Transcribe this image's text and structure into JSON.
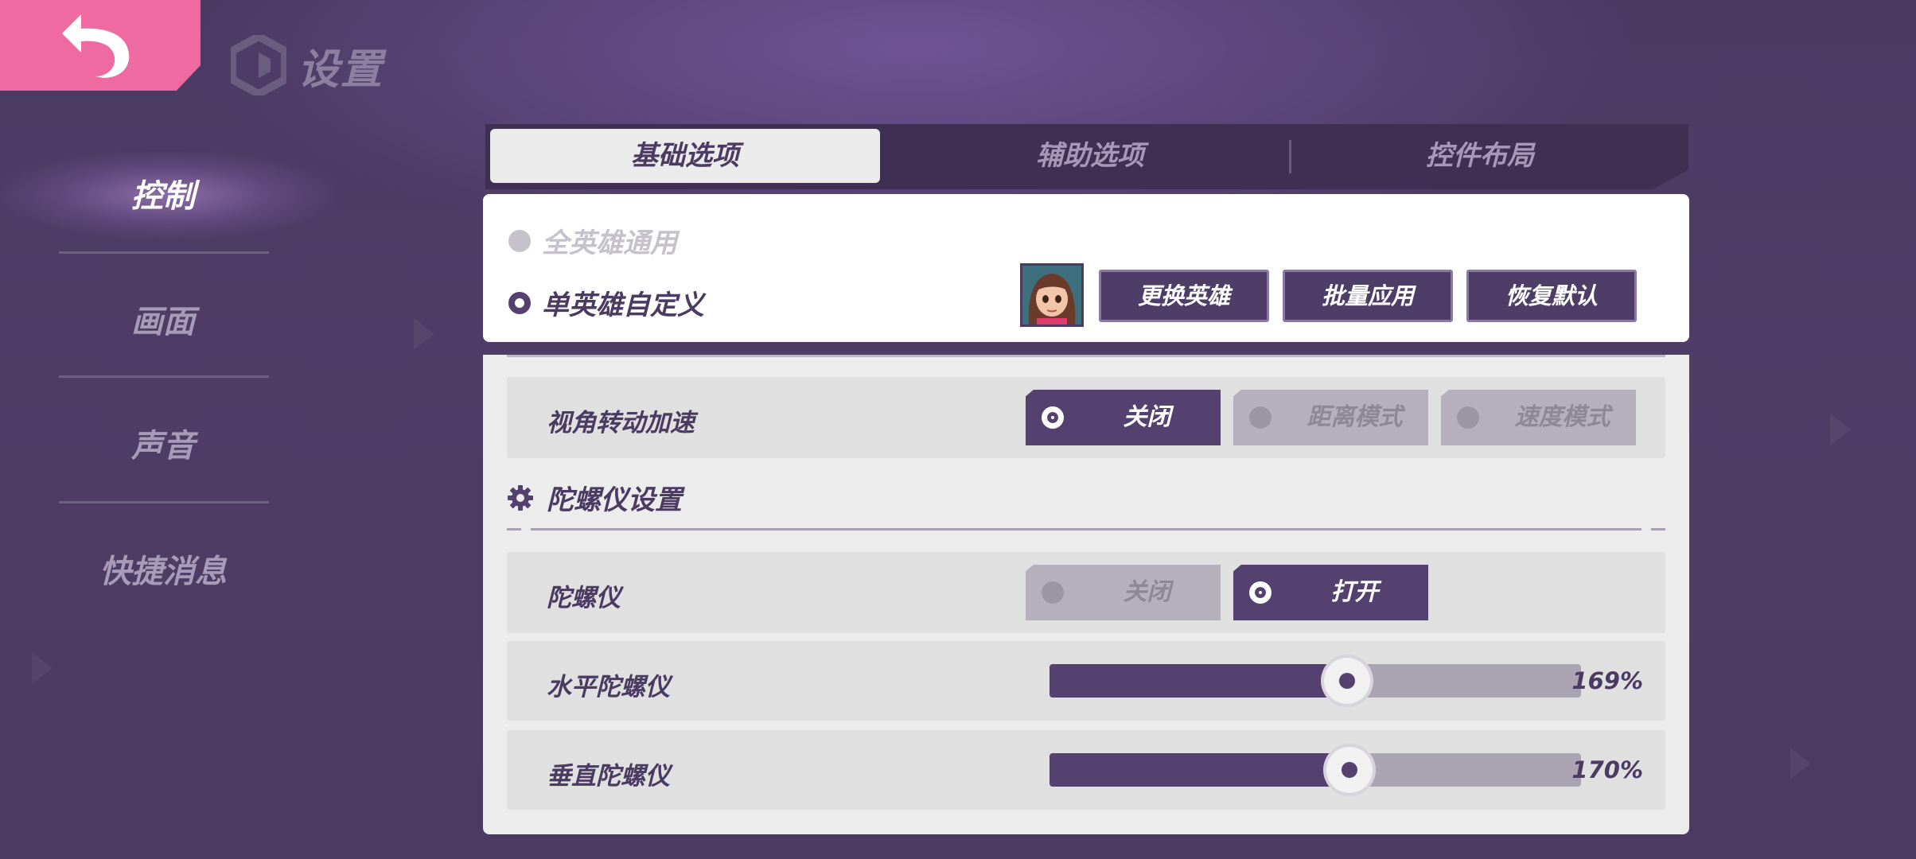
{
  "header": {
    "title": "设置"
  },
  "sidebar": {
    "items": [
      {
        "label": "控制",
        "active": true
      },
      {
        "label": "画面",
        "active": false
      },
      {
        "label": "声音",
        "active": false
      },
      {
        "label": "快捷消息",
        "active": false
      }
    ]
  },
  "tabs": [
    {
      "label": "基础选项",
      "active": true
    },
    {
      "label": "辅助选项",
      "active": false
    },
    {
      "label": "控件布局",
      "active": false
    }
  ],
  "hero_mode": {
    "options": [
      {
        "label": "全英雄通用",
        "selected": false
      },
      {
        "label": "单英雄自定义",
        "selected": true
      }
    ],
    "buttons": {
      "change_hero": "更换英雄",
      "batch_apply": "批量应用",
      "restore_default": "恢复默认"
    }
  },
  "camera_accel": {
    "label": "视角转动加速",
    "options": [
      "关闭",
      "距离模式",
      "速度模式"
    ],
    "selected": "关闭"
  },
  "gyro_section": {
    "title": "陀螺仪设置"
  },
  "gyro": {
    "label": "陀螺仪",
    "options": [
      "关闭",
      "打开"
    ],
    "selected": "打开"
  },
  "horizontal_gyro": {
    "label": "水平陀螺仪",
    "value_text": "169%",
    "fill_fraction": 0.56
  },
  "vertical_gyro": {
    "label": "垂直陀螺仪",
    "value_text": "170%",
    "fill_fraction": 0.565
  },
  "colors": {
    "accent": "#55416f",
    "back_button": "#f06aa2",
    "background": "#4b3a62"
  }
}
